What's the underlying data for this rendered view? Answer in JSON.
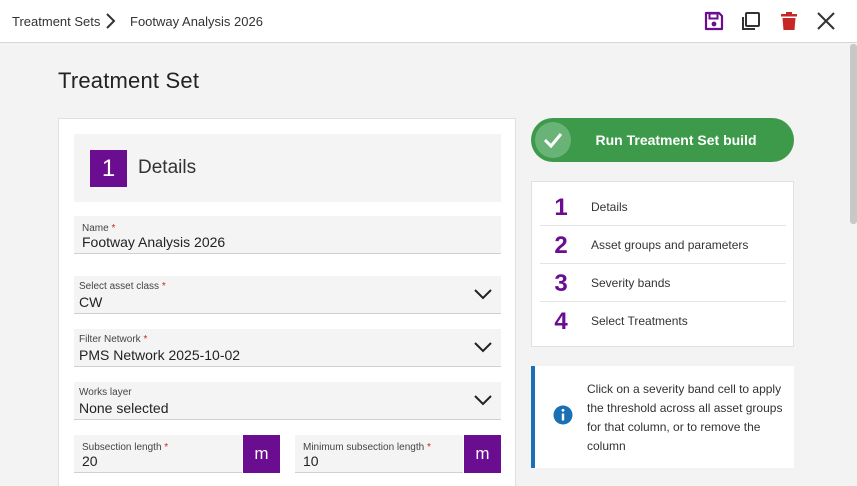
{
  "breadcrumb": {
    "parent": "Treatment Sets",
    "current": "Footway Analysis 2026"
  },
  "toolbar": {
    "icons": [
      "save-icon",
      "copy-icon",
      "delete-icon",
      "close-icon"
    ],
    "accent_color": "#6a0d91",
    "danger_color": "#c62828"
  },
  "page": {
    "title": "Treatment Set"
  },
  "section": {
    "number": "1",
    "title": "Details"
  },
  "form": {
    "name": {
      "label": "Name",
      "required_mark": "*",
      "value": "Footway Analysis 2026"
    },
    "asset_class": {
      "label": "Select asset class",
      "required_mark": "*",
      "value": "CW"
    },
    "filter_network": {
      "label": "Filter Network",
      "required_mark": "*",
      "value": "PMS Network 2025-10-02"
    },
    "works_layer": {
      "label": "Works layer",
      "value": "None selected"
    },
    "subsection_length": {
      "label": "Subsection length",
      "required_mark": "*",
      "value": "20",
      "unit": "m"
    },
    "min_subsection_length": {
      "label": "Minimum subsection length",
      "required_mark": "*",
      "value": "10",
      "unit": "m"
    }
  },
  "run_button": {
    "label": "Run Treatment Set build",
    "color": "#3d9a4b"
  },
  "steps": [
    {
      "number": "1",
      "label": "Details"
    },
    {
      "number": "2",
      "label": "Asset groups and parameters"
    },
    {
      "number": "3",
      "label": "Severity bands"
    },
    {
      "number": "4",
      "label": "Select Treatments"
    }
  ],
  "info": {
    "text": "Click on a severity band cell to apply the threshold across all asset groups for that column, or to remove the column",
    "color": "#1a6fb5"
  }
}
